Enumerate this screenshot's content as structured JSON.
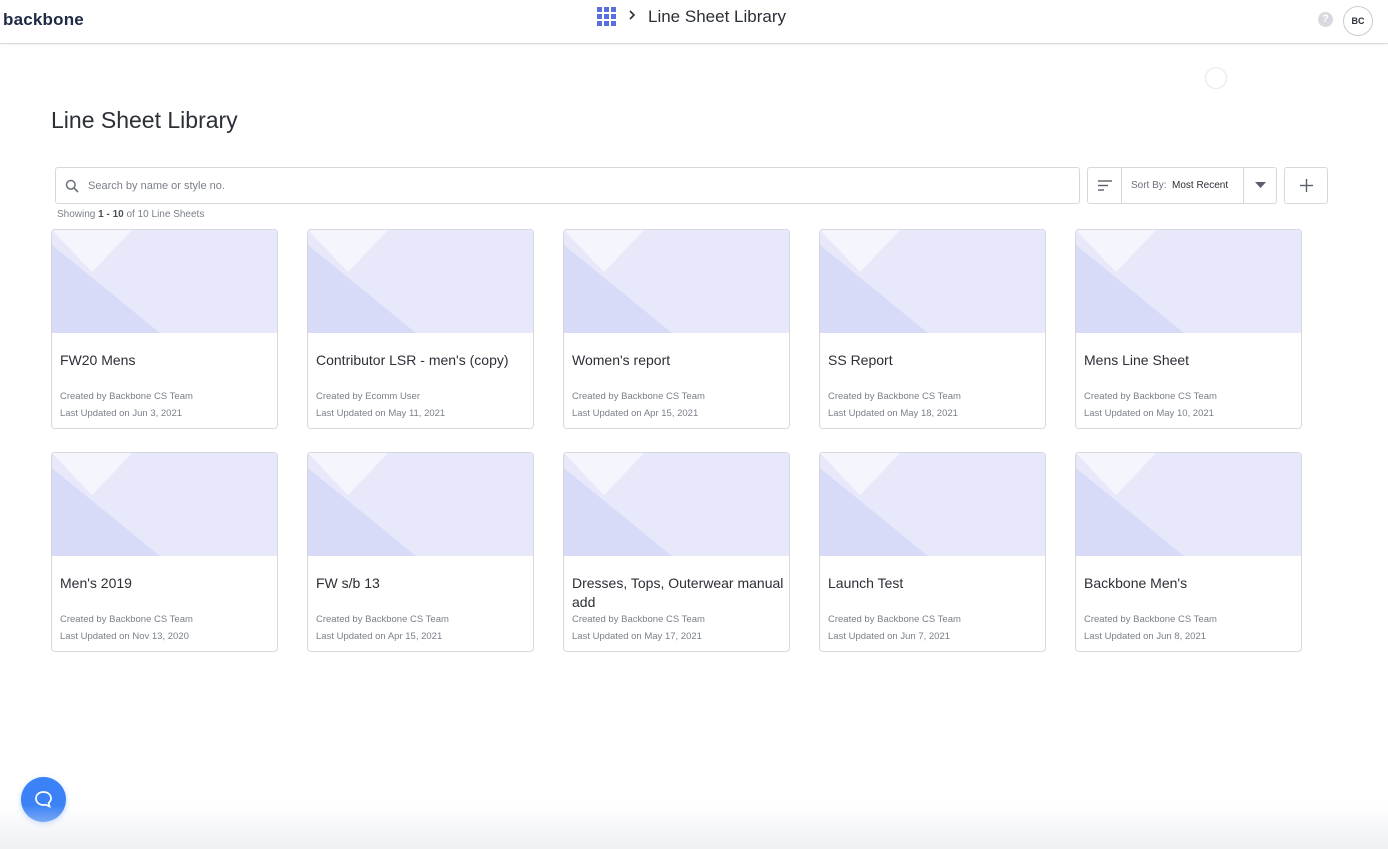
{
  "header": {
    "logo": "backbone",
    "breadcrumb_title": "Line Sheet Library",
    "help_label": "?",
    "avatar_initials": "BC"
  },
  "page": {
    "title": "Line Sheet Library"
  },
  "search": {
    "placeholder": "Search by name or style no.",
    "value": ""
  },
  "sort": {
    "label": "Sort By:",
    "value": "Most Recent"
  },
  "showing": {
    "prefix": "Showing",
    "range": "1 - 10",
    "suffix": "of 10 Line Sheets"
  },
  "colors": {
    "accent": "#5b6ee1",
    "thumb_bg": "#e7e9fb",
    "thumb_shape": "#d8dbf7",
    "chat": "#3b82f6"
  },
  "cards": [
    {
      "title": "FW20 Mens",
      "creator": "Created by Backbone CS Team",
      "updated": "Last Updated on Jun 3, 2021"
    },
    {
      "title": "Contributor LSR - men's (copy)",
      "creator": "Created by Ecomm User",
      "updated": "Last Updated on May 11, 2021"
    },
    {
      "title": "Women's report",
      "creator": "Created by Backbone CS Team",
      "updated": "Last Updated on Apr 15, 2021"
    },
    {
      "title": "SS Report",
      "creator": "Created by Backbone CS Team",
      "updated": "Last Updated on May 18, 2021"
    },
    {
      "title": "Mens Line Sheet",
      "creator": "Created by Backbone CS Team",
      "updated": "Last Updated on May 10, 2021"
    },
    {
      "title": "Men's 2019",
      "creator": "Created by Backbone CS Team",
      "updated": "Last Updated on Nov 13, 2020"
    },
    {
      "title": "FW s/b 13",
      "creator": "Created by Backbone CS Team",
      "updated": "Last Updated on Apr 15, 2021"
    },
    {
      "title": "Dresses, Tops, Outerwear manual add",
      "creator": "Created by Backbone CS Team",
      "updated": "Last Updated on May 17, 2021"
    },
    {
      "title": "Launch Test",
      "creator": "Created by Backbone CS Team",
      "updated": "Last Updated on Jun 7, 2021"
    },
    {
      "title": "Backbone Men's",
      "creator": "Created by Backbone CS Team",
      "updated": "Last Updated on Jun 8, 2021"
    }
  ]
}
